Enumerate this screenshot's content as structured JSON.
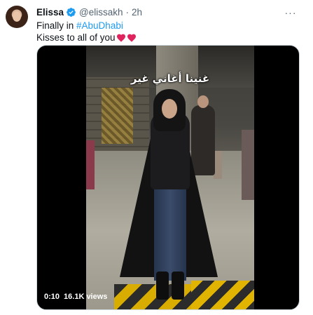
{
  "tweet": {
    "author_name": "Elissa",
    "author_handle": "@elissakh",
    "separator": "·",
    "time": "2h",
    "more_label": "···",
    "text_line1_prefix": "Finally in ",
    "hashtag": "#AbuDhabi",
    "text_line2": "Kisses to all of you",
    "emoji": [
      "red-heart",
      "red-heart"
    ]
  },
  "video": {
    "overlay_caption": "غنينا أغاني غير",
    "duration": "0:10",
    "views": "16.1K views"
  },
  "colors": {
    "link": "#1d9bf0",
    "secondary_text": "#536471",
    "verified_badge": "#1d9bf0",
    "heart": "#e0245e"
  }
}
